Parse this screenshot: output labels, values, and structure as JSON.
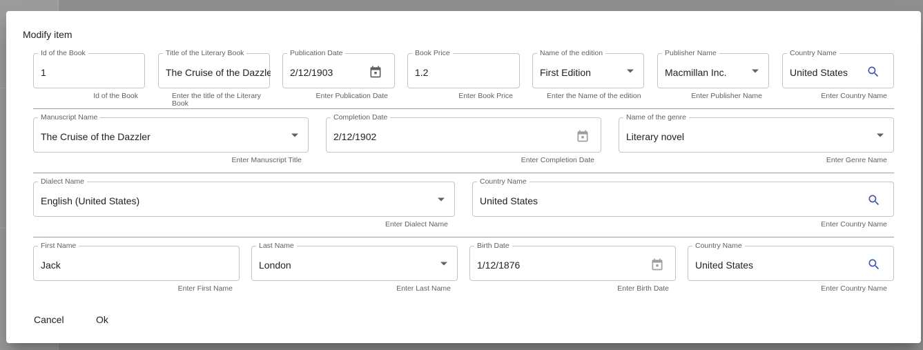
{
  "dialog": {
    "title": "Modify item",
    "cancel_label": "Cancel",
    "ok_label": "Ok"
  },
  "book": {
    "id": {
      "label": "Id of the Book",
      "value": "1",
      "helper": "Id of the Book"
    },
    "title": {
      "label": "Title of the Literary Book",
      "value": "The Cruise of the Dazzler",
      "helper": "Enter the title of the Literary Book"
    },
    "publication_date": {
      "label": "Publication Date",
      "value": "2/12/1903",
      "helper": "Enter Publication Date",
      "icon": "calendar-icon"
    },
    "price": {
      "label": "Book Price",
      "value": "1.2",
      "helper": "Enter Book Price"
    },
    "edition": {
      "label": "Name of the edition",
      "value": "First Edition",
      "helper": "Enter the Name of the edition",
      "icon": "chevron-down-icon"
    },
    "publisher": {
      "label": "Publisher Name",
      "value": "Macmillan Inc.",
      "helper": "Enter Publisher Name",
      "icon": "chevron-down-icon"
    },
    "country": {
      "label": "Country Name",
      "value": "United States",
      "helper": "Enter Country Name",
      "icon": "search-icon"
    }
  },
  "manuscript": {
    "name": {
      "label": "Manuscript Name",
      "value": "The Cruise of the Dazzler",
      "helper": "Enter Manuscript Title",
      "icon": "chevron-down-icon"
    },
    "completion_date": {
      "label": "Completion Date",
      "value": "2/12/1902",
      "helper": "Enter Completion Date",
      "icon": "calendar-icon"
    },
    "genre": {
      "label": "Name of the genre",
      "value": "Literary novel",
      "helper": "Enter Genre Name",
      "icon": "chevron-down-icon"
    }
  },
  "language": {
    "dialect": {
      "label": "Dialect Name",
      "value": "English (United States)",
      "helper": "Enter Dialect Name",
      "icon": "chevron-down-icon"
    },
    "country": {
      "label": "Country Name",
      "value": "United States",
      "helper": "Enter Country Name",
      "icon": "search-icon"
    }
  },
  "author": {
    "first_name": {
      "label": "First Name",
      "value": "Jack",
      "helper": "Enter First Name"
    },
    "last_name": {
      "label": "Last Name",
      "value": "London",
      "helper": "Enter Last Name",
      "icon": "chevron-down-icon"
    },
    "birth_date": {
      "label": "Birth Date",
      "value": "1/12/1876",
      "helper": "Enter Birth Date",
      "icon": "calendar-icon"
    },
    "country": {
      "label": "Country Name",
      "value": "United States",
      "helper": "Enter Country Name",
      "icon": "search-icon"
    }
  },
  "colors": {
    "accent": "#3f51b5",
    "icon_dark": "#616161",
    "icon_disabled": "#9e9e9e",
    "border": "#c4c4c4"
  }
}
